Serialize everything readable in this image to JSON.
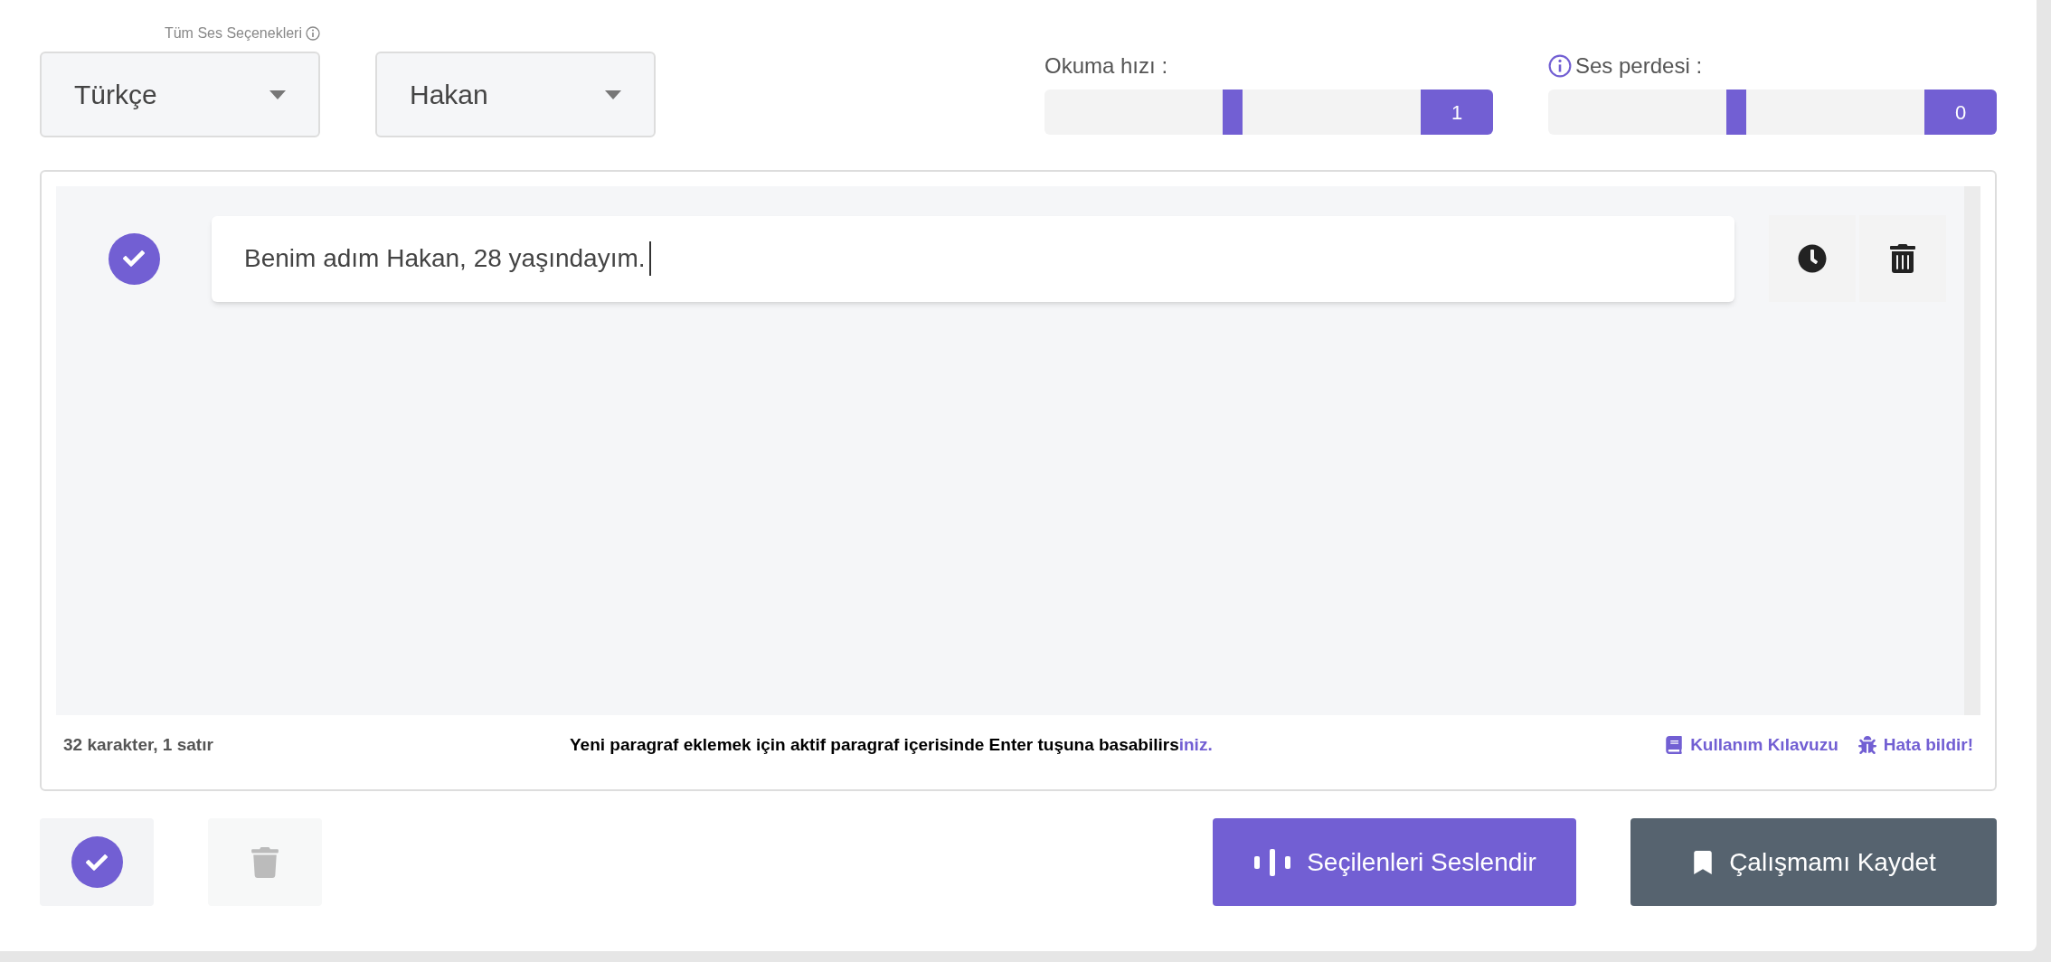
{
  "voice_options_label": "Tüm Ses Seçenekleri",
  "selects": [
    {
      "value": "Türkçe"
    },
    {
      "value": "Hakan"
    }
  ],
  "sliders": [
    {
      "label": "Okuma hızı :",
      "info": false,
      "level": 0.5,
      "reading": "1"
    },
    {
      "label": "Ses perdesi :",
      "info": true,
      "level": 0.5,
      "reading": "0"
    }
  ],
  "paragraphs": [
    {
      "text": "Benim adım Hakan, 28 yaşındayım.",
      "selected": true
    }
  ],
  "status": {
    "count": "32 karakter, 1 satır",
    "hint": "Yeni paragraf eklemek için aktif paragraf içerisinde Enter tuşuna basabilirs",
    "hint_tail": "iniz.",
    "links": [
      {
        "kind": "guide",
        "label": "Kullanım Kılavuzu"
      },
      {
        "kind": "bug",
        "label": "Hata bildir!"
      }
    ]
  },
  "actions": [
    {
      "kind": "speak",
      "label": "Seçilenleri Seslendir"
    },
    {
      "kind": "save",
      "label": "Çalışmamı Kaydet"
    }
  ]
}
